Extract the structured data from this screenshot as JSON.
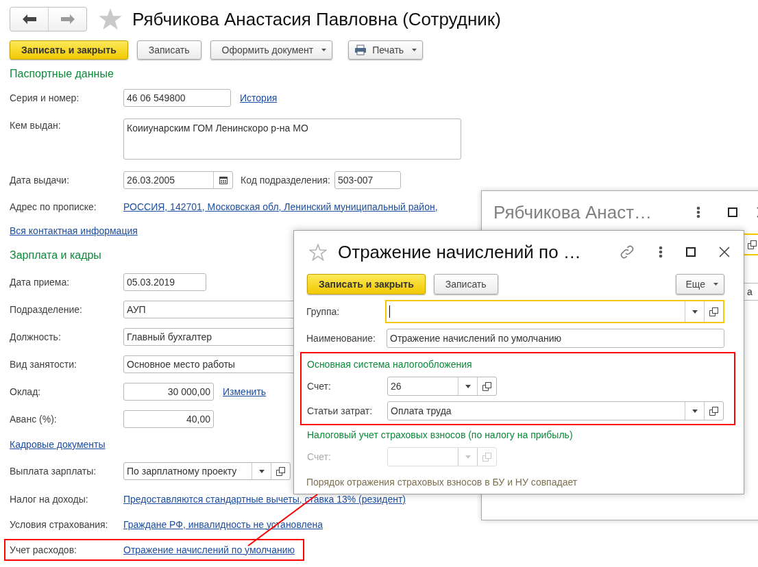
{
  "window": {
    "title": "Рябчикова Анастасия Павловна (Сотрудник)"
  },
  "toolbar": [
    {
      "label": "Записать и закрыть",
      "kind": "primary"
    },
    {
      "label": "Записать",
      "kind": "plain"
    },
    {
      "label": "Оформить документ",
      "kind": "menu"
    },
    {
      "label": "Печать",
      "kind": "print"
    }
  ],
  "rows": [
    {
      "kind": "section",
      "text": "Паспортные данные"
    },
    {
      "kind": "text",
      "label": "Серия и номер:",
      "value": "46 06 549800",
      "link": "История",
      "highlighted": false
    },
    {
      "kind": "textarea",
      "label": "Кем выдан:",
      "value": "Коииунарским ГОМ Ленинскоро р-на МО",
      "highlighted": false
    },
    {
      "kind": "date",
      "label": "Дата выдачи:",
      "value": "26.03.2005",
      "extra_label": "Код подразделения:",
      "extra_value": "503-007",
      "highlighted": false
    },
    {
      "kind": "linkvalue",
      "label": "Адрес по прописке:",
      "link": "РОССИЯ, 142701, Московская обл, Ленинский муниципальный район,",
      "highlighted": false
    },
    {
      "kind": "link",
      "link": "Вся контактная информация"
    },
    {
      "kind": "section",
      "text": "Зарплата и кадры"
    },
    {
      "kind": "shortdate",
      "label": "Дата приема:",
      "value": "05.03.2019",
      "highlighted": false
    },
    {
      "kind": "wide",
      "label": "Подразделение:",
      "value": "АУП",
      "highlighted": false
    },
    {
      "kind": "wide",
      "label": "Должность:",
      "value": "Главный бухгалтер",
      "highlighted": false
    },
    {
      "kind": "wide",
      "label": "Вид занятости:",
      "value": "Основное место работы",
      "highlighted": false
    },
    {
      "kind": "number",
      "label": "Оклад:",
      "value": "30 000,00",
      "link": "Изменить",
      "highlighted": false
    },
    {
      "kind": "number",
      "label": "Аванс (%):",
      "value": "40,00",
      "highlighted": false
    },
    {
      "kind": "link",
      "link": "Кадровые документы"
    },
    {
      "kind": "select",
      "label": "Выплата зарплаты:",
      "value": "По зарплатному проекту",
      "highlighted": false
    },
    {
      "kind": "linkvalue",
      "label": "Налог на доходы:",
      "link": "Предоставляются стандартные вычеты, ставка 13% (резидент)",
      "highlighted": false
    },
    {
      "kind": "linkvalue",
      "label": "Условия страхования:",
      "link": "Граждане РФ, инвалидность не установлена",
      "highlighted": false
    },
    {
      "kind": "linkvalue",
      "label": "Учет расходов:",
      "link": "Отражение начислений по умолчанию",
      "highlighted": true
    }
  ],
  "background_window": {
    "title": "Рябчикова Анаст…",
    "field_text": "а"
  },
  "dialog": {
    "title": "Отражение начислений по …",
    "buttons": [
      {
        "label": "Записать и закрыть",
        "kind": "primary"
      },
      {
        "label": "Записать",
        "kind": "plain"
      },
      {
        "label": "Еще",
        "kind": "menu"
      }
    ],
    "rows": [
      {
        "kind": "combo",
        "label": "Группа:",
        "focused": true
      },
      {
        "kind": "text",
        "label": "Наименование:",
        "value": "Отражение начислений по умолчанию",
        "focused": false
      }
    ],
    "groups": [
      {
        "title": "Основная система налогообложения",
        "highlighted": true,
        "rows": [
          {
            "kind": "combo-short",
            "label": "Счет:",
            "value": "26",
            "disabled": false
          },
          {
            "kind": "combo",
            "label": "Статьи затрат:",
            "value": "Оплата труда",
            "disabled": false
          }
        ]
      },
      {
        "title": "Налоговый учет страховых взносов (по налогу на прибыль)",
        "highlighted": false,
        "rows": [
          {
            "kind": "combo-short",
            "label": "Счет:",
            "disabled": true
          }
        ]
      }
    ],
    "note": "Порядок отражения страховых взносов в БУ и НУ совпадает"
  }
}
